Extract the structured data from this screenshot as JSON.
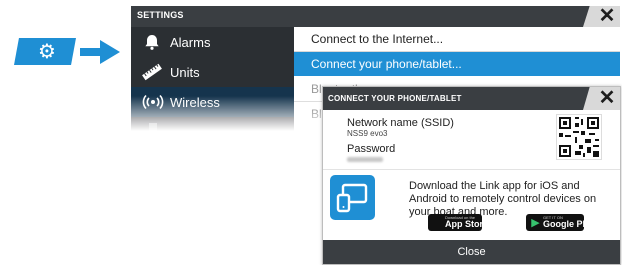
{
  "icons": {
    "settings": "gear-icon",
    "alarms": "bell-icon",
    "units": "ruler-icon",
    "wireless": "wireless-icon",
    "close": "close-icon",
    "link_app": "link-app-icon",
    "apple": "apple-icon",
    "google_play": "google-play-icon"
  },
  "colors": {
    "accent": "#1f8fd4",
    "panel_dark": "#2b2f33",
    "header": "#3a3e42",
    "menu_active": "#15344d"
  },
  "settings": {
    "title": "SETTINGS",
    "close_label": "✕",
    "menu": [
      {
        "label": "Alarms",
        "icon": "bell-icon",
        "active": false
      },
      {
        "label": "Units",
        "icon": "ruler-icon",
        "active": false
      },
      {
        "label": "Wireless",
        "icon": "wireless-icon",
        "active": true
      }
    ],
    "options": [
      {
        "label": "Connect to the Internet..."
      },
      {
        "label": "Connect your phone/tablet...",
        "selected": true
      },
      {
        "label": "Bluetooth"
      },
      {
        "label": "Bl"
      }
    ]
  },
  "dialog": {
    "title": "CONNECT YOUR PHONE/TABLET",
    "close_label": "✕",
    "network_name_label": "Network name (SSID)",
    "network_name_value": "NSS9 evo3",
    "password_label": "Password",
    "download_text": "Download the Link app for iOS and Android to remotely control devices on your boat and more.",
    "app_store": {
      "small": "Download on the",
      "big": "App Store"
    },
    "google_play": {
      "small": "GET IT ON",
      "big": "Google Play"
    },
    "footer": "Close"
  }
}
